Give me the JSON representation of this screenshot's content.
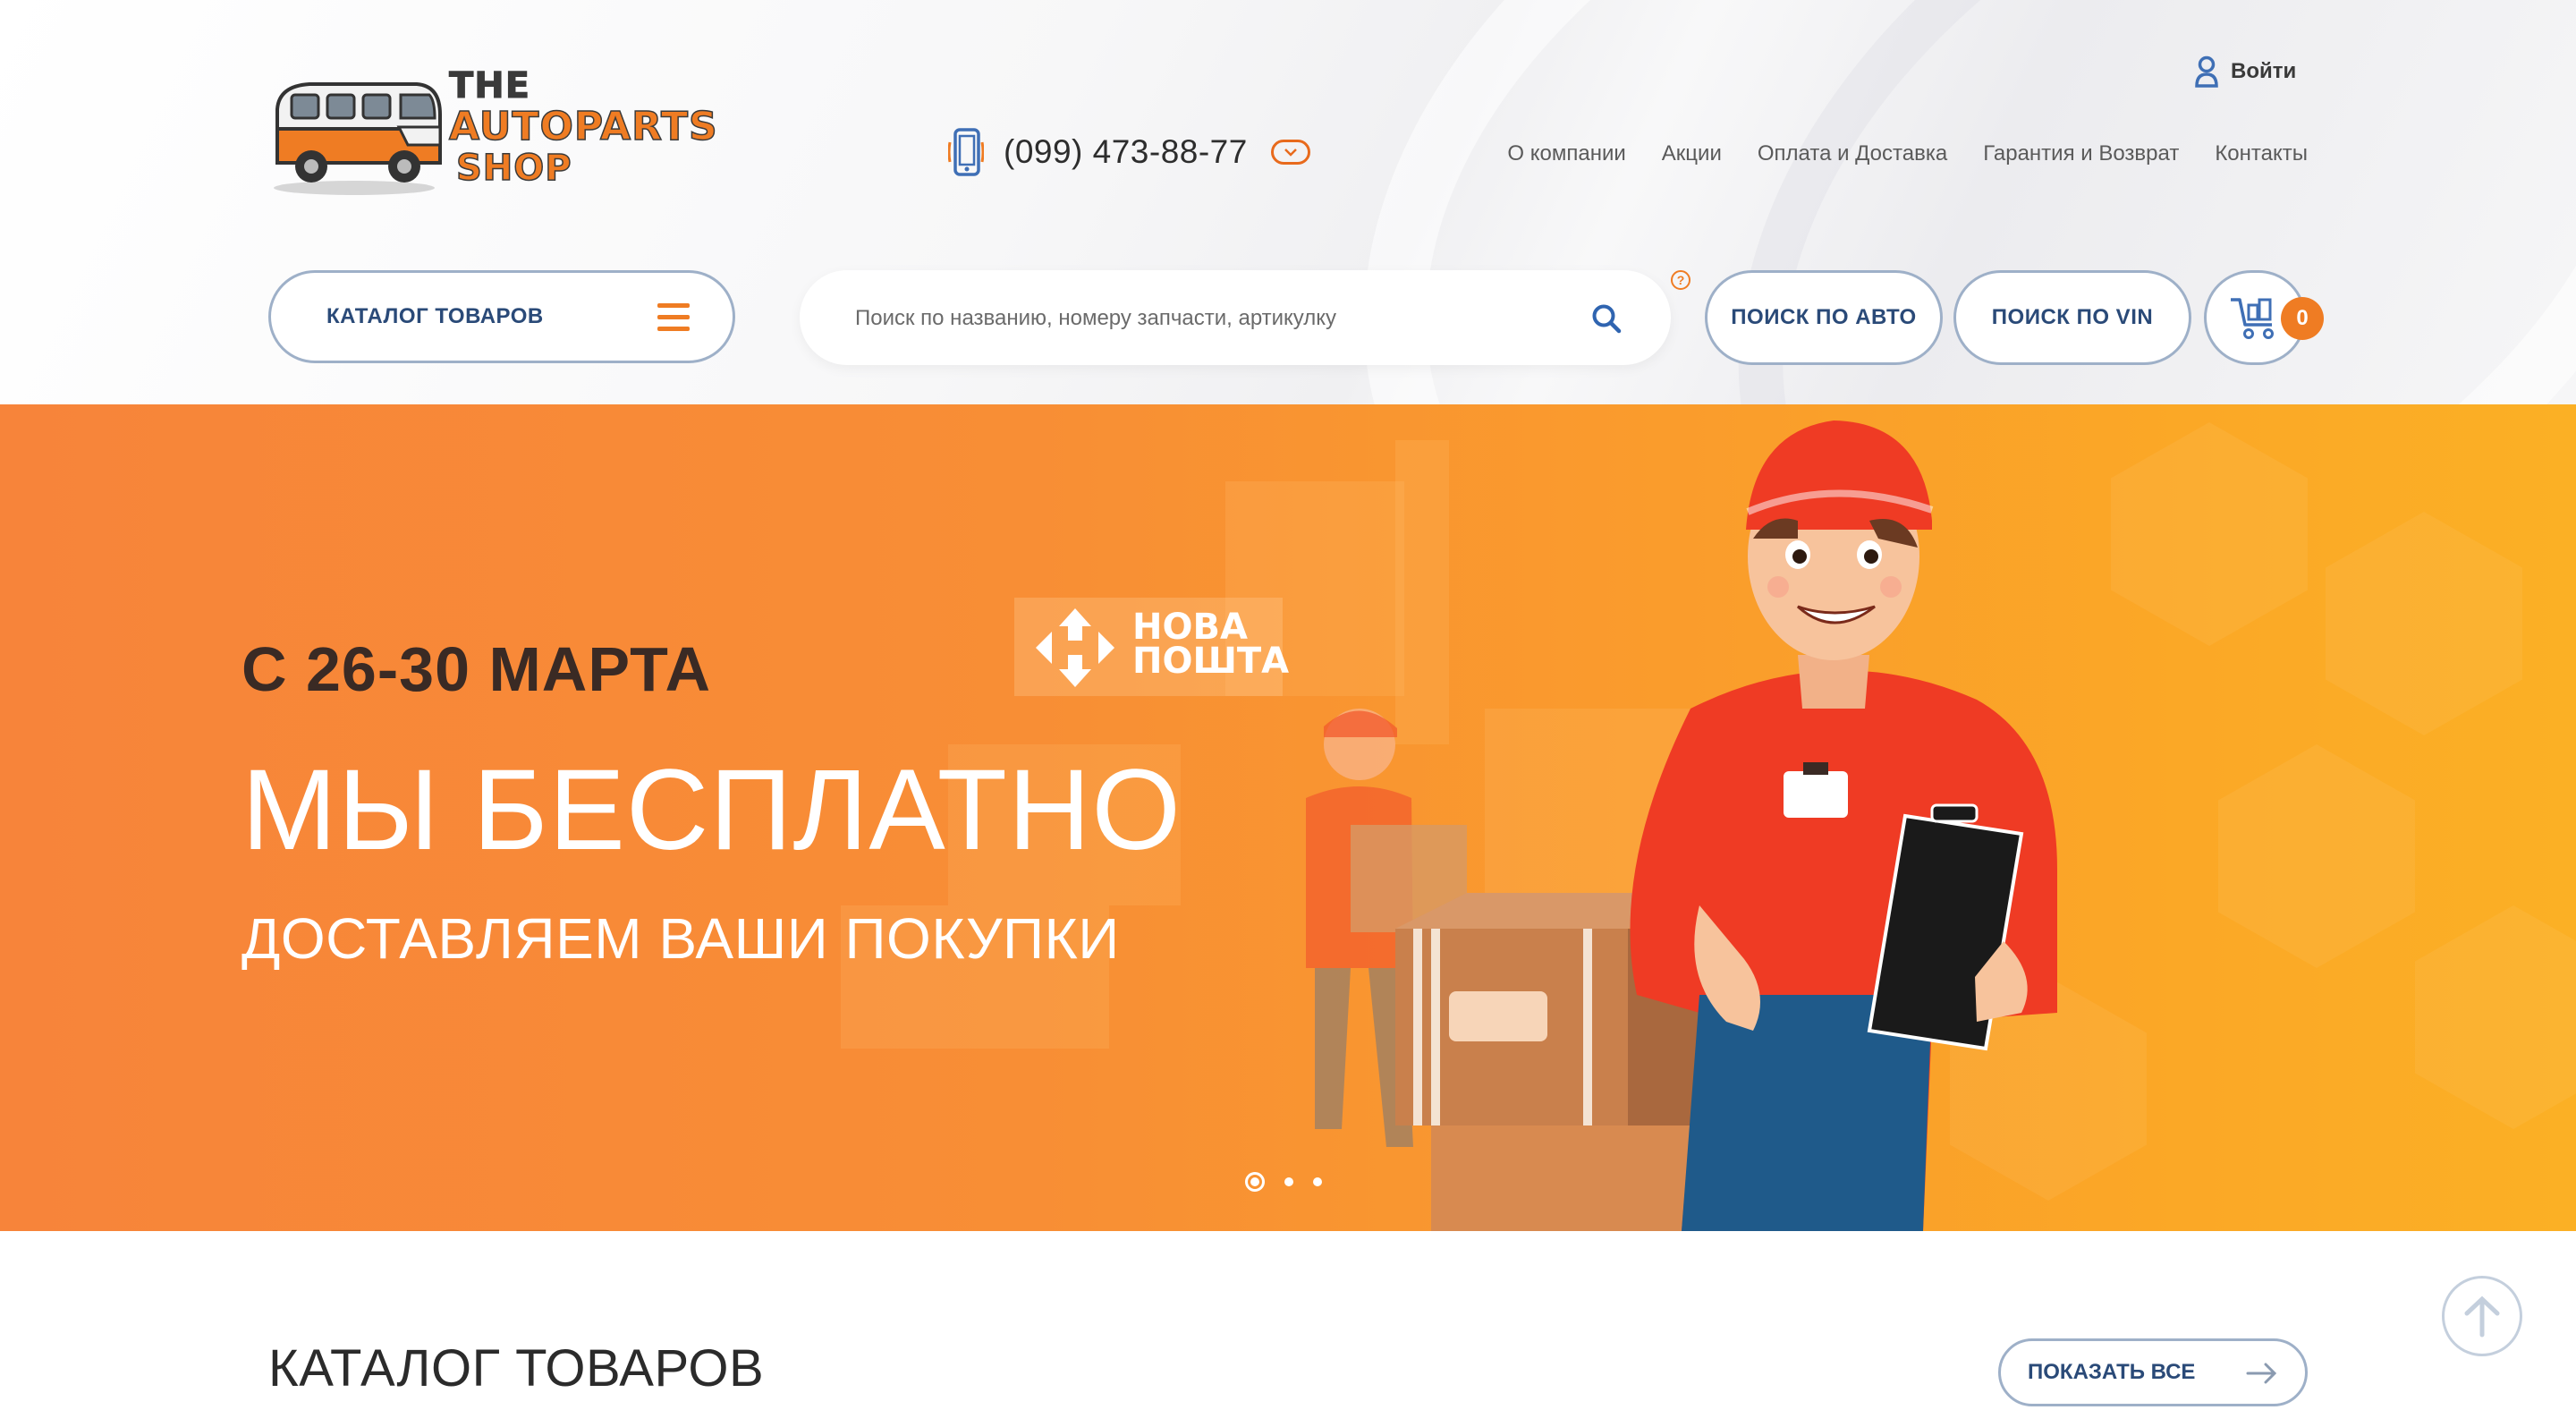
{
  "header": {
    "logo": {
      "line1": "THE",
      "line2": "AUTOPARTS",
      "line3": "SHOP"
    },
    "phone": "(099) 473-88-77",
    "login_label": "Войти",
    "nav": [
      "О компании",
      "Акции",
      "Оплата и Доставка",
      "Гарантия и Возврат",
      "Контакты"
    ]
  },
  "toolbar": {
    "catalog_label": "КАТАЛОГ ТОВАРОВ",
    "search_placeholder": "Поиск по названию, номеру запчасти, артикулку",
    "help_label": "?",
    "search_auto_label": "ПОИСК ПО АВТО",
    "search_vin_label": "ПОИСК ПО VIN",
    "cart_count": "0"
  },
  "hero": {
    "date": "С 26-30 МАРТА",
    "title": "МЫ БЕСПЛАТНО",
    "subtitle": "ДОСТАВЛЯЕМ ВАШИ ПОКУПКИ",
    "brand_line1": "НОВА",
    "brand_line2": "ПОШТА",
    "slides_count": 3,
    "active_slide": 1
  },
  "catalog_section": {
    "title": "КАТАЛОГ ТОВАРОВ",
    "show_all_label": "ПОКАЗАТЬ ВСЕ"
  },
  "colors": {
    "accent": "#ef7c23",
    "link_blue": "#2a4a78",
    "border_blue": "#9eb0c8",
    "hero_start": "#f7843a",
    "hero_end": "#fbb025"
  },
  "icons": [
    "phone-icon",
    "chevron-down-icon",
    "user-icon",
    "menu-icon",
    "search-icon",
    "help-icon",
    "cart-icon",
    "arrow-right-icon",
    "arrow-up-icon"
  ]
}
